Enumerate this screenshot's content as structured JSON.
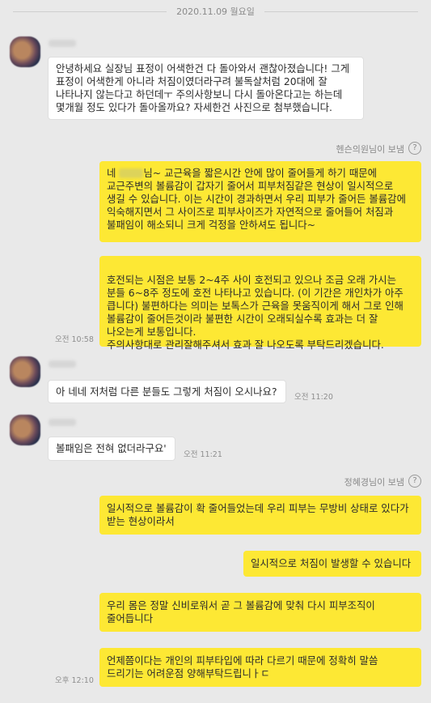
{
  "date_divider": "2020.11.09 월요일",
  "messages": [
    {
      "text": "안녕하세요 실장님 표정이 어색한건 다 돌아와서 괜찮아졌습니다! 그게 표정이 어색한게 아니라 처짐이였더라구려 불독살처럼 20대에 잘 나타나지 않는다고 하던데ㅜ 주의사항보니 다시 돌아온다고는 하는데 몇개월 정도 있다가 돌아올까요? 자세한건 사진으로 첨부했습니다."
    },
    {
      "sent_by": "헨슨의원님이 보냄",
      "text_before_name": "네 ",
      "text": "님~ 교근육을 짧은시간 안에 많이 줄어들게 하기 때문에 교근주변의 볼륨감이 갑자기 줄어서 피부처짐같은 현상이 일시적으로 생길 수 있습니다. 이는 시간이 경과하면서 우리 피부가 줄어든 볼륨감에 익숙해지면서 그 사이즈로 피부사이즈가 자연적으로 줄어들어 처짐과 불패임이 해소되니 크게 걱정을 안하셔도 됩니다~"
    },
    {
      "text": "호전되는 시점은 보통 2~4주 사이 호전되고 있으나 조금 오래 가시는 분들 6~8주 정도에 호전 나타나고 있습니다. (이 기간은 개인차가 아주 큽니다) 불편하다는 의미는 보톡스가 근육을 못움직이게 해서 그로 인해 볼륨감이 줄어든것이라 불편한 시간이 오래되실수록 효과는 더 잘 나오는게 보통입니다.\n주의사항대로 관리잘해주셔서 효과 잘 나오도록 부탁드리겠습니다.",
      "time": "오전 10:58"
    },
    {
      "text": "아 네네 저처럼 다른 분들도 그렇게 처짐이 오시나요?",
      "time": "오전 11:20"
    },
    {
      "text": "볼패임은 전혀 없더라구요'",
      "time": "오전 11:21"
    },
    {
      "sent_by": "정혜경님이 보냄",
      "text": "일시적으로 볼륨감이 확 줄어들었는데 우리 피부는 무방비 상태로 있다가 받는 현상이라서"
    },
    {
      "text": "일시적으로 처짐이 발생할 수 있습니다"
    },
    {
      "text": "우리 몸은 정말 신비로워서 곧 그 볼륨감에 맞춰 다시 피부조직이 줄어듭니다"
    },
    {
      "text": "언제쯤이다는 개인의 피부타입에 따라 다르기 때문에 정확히 말씀 드리기는 어려운점 양해부탁드립니ㅏㄷ",
      "time": "오후 12:10"
    }
  ],
  "help_icon": "?",
  "colors": {
    "background": "#e9e9e9",
    "outgoing_bubble": "#fde834",
    "incoming_bubble": "#ffffff"
  }
}
